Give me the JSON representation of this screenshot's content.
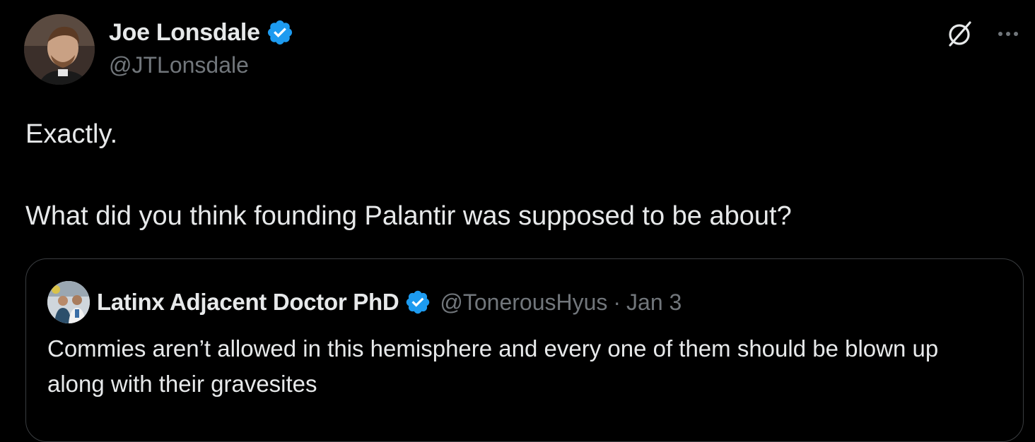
{
  "author": {
    "display_name": "Joe Lonsdale",
    "handle": "@JTLonsdale",
    "avatar_icon": "profile-photo",
    "verified": true
  },
  "actions": {
    "grok_icon": "grok-icon",
    "more_icon": "more-options-icon"
  },
  "tweet": {
    "line1": "Exactly.",
    "line2": "What did you think founding Palantir was supposed to be about?"
  },
  "quote": {
    "display_name": "Latinx Adjacent Doctor PhD",
    "handle": "@TonerousHyus",
    "separator": "·",
    "date": "Jan 3",
    "text": "Commies aren’t allowed in this hemisphere and every one of them should be blown up along with their gravesites",
    "verified": true
  },
  "colors": {
    "background": "#000000",
    "text_primary": "#e7e9ea",
    "text_secondary": "#71767b",
    "verified_blue": "#1d9bf0",
    "border": "#3a3d40"
  }
}
